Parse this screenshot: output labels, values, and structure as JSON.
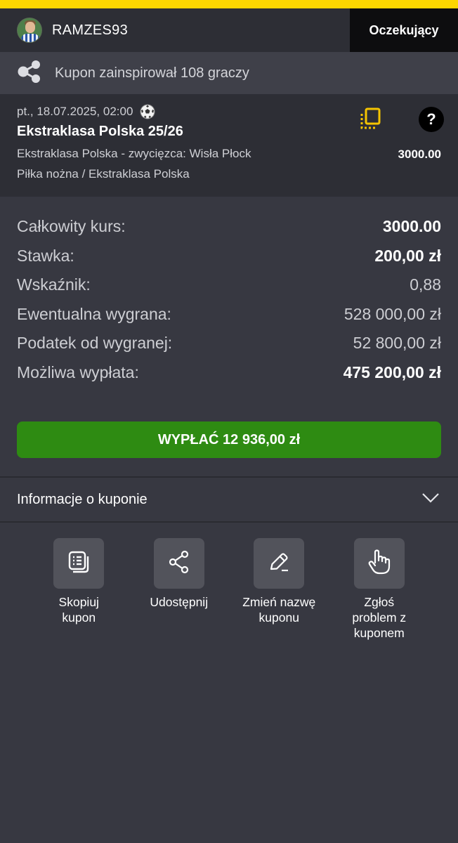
{
  "header": {
    "username": "RAMZES93",
    "status": "Oczekujący"
  },
  "inspire": {
    "text": "Kupon zainspirował 108 graczy"
  },
  "match": {
    "date": "pt., 18.07.2025, 02:00",
    "title": "Ekstraklasa Polska 25/26",
    "selection": "Ekstraklasa Polska - zwycięzca: Wisła Płock",
    "sport": "Piłka nożna / Ekstraklasa Polska",
    "odd": "3000.00",
    "help_label": "?"
  },
  "summary": {
    "rows": [
      {
        "label": "Całkowity kurs:",
        "value": "3000.00"
      },
      {
        "label": "Stawka:",
        "value": "200,00 zł"
      },
      {
        "label": "Wskaźnik:",
        "value": "0,88"
      },
      {
        "label": "Ewentualna wygrana:",
        "value": "528 000,00 zł"
      },
      {
        "label": "Podatek od wygranej:",
        "value": "52 800,00 zł"
      },
      {
        "label": "Możliwa wypłata:",
        "value": "475 200,00 zł"
      }
    ]
  },
  "payout_button": "WYPŁAĆ 12 936,00 zł",
  "info": {
    "label": "Informacje o kuponie"
  },
  "actions": [
    {
      "label": "Skopiuj\nkupon"
    },
    {
      "label": "Udostępnij"
    },
    {
      "label": "Zmień nazwę\nkuponu"
    },
    {
      "label": "Zgłoś\nproblem z\nkuponem"
    }
  ],
  "colors": {
    "accent_yellow": "#fdd600",
    "payout_green": "#2e8b12",
    "background": "#373841"
  }
}
